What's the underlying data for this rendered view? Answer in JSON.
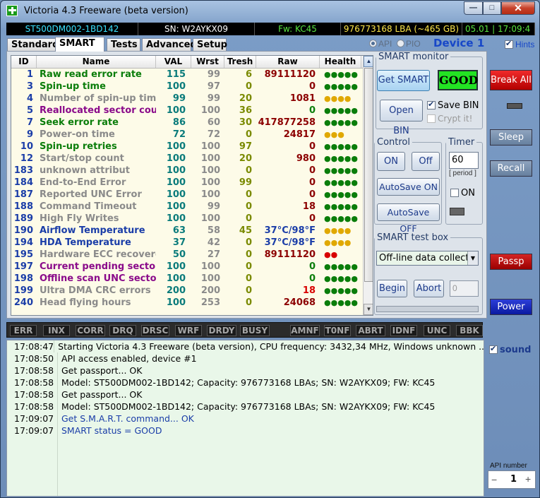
{
  "window": {
    "title": "Victoria 4.3 Freeware (beta version)",
    "min": "—",
    "max": "□",
    "close": "✕"
  },
  "info": {
    "model": "ST500DM002-1BD142",
    "serial": "SN: W2AYKX09",
    "firmware": "Fw: KC45",
    "lba": "976773168 LBA (~465 GB)",
    "time": "05.01 | 17:09:4"
  },
  "tabs": [
    "Standard",
    "SMART",
    "Tests",
    "Advanced",
    "Setup"
  ],
  "active_tab": "SMART",
  "iface": {
    "api": "API",
    "pio": "PIO",
    "device": "Device 1",
    "hints": "Hints"
  },
  "table": {
    "headers": [
      "ID",
      "Name",
      "VAL",
      "Wrst",
      "Tresh",
      "Raw",
      "Health"
    ],
    "rows": [
      {
        "id": "1",
        "name": "Raw read error rate",
        "val": "115",
        "wrst": "99",
        "tresh": "6",
        "raw": "89111120",
        "health": "●●●●●",
        "nc": "#0a7d0a",
        "hc": "#0a7d0a"
      },
      {
        "id": "3",
        "name": "Spin-up time",
        "val": "100",
        "wrst": "97",
        "tresh": "0",
        "raw": "0",
        "health": "●●●●●",
        "nc": "#0a7d0a",
        "hc": "#0a7d0a"
      },
      {
        "id": "4",
        "name": "Number of spin-up times",
        "val": "99",
        "wrst": "99",
        "tresh": "20",
        "raw": "1081",
        "health": "●●●●",
        "nc": "#8a8a8a",
        "hc": "#e0a800"
      },
      {
        "id": "5",
        "name": "Reallocated sector count",
        "val": "100",
        "wrst": "100",
        "tresh": "36",
        "raw": "0",
        "health": "●●●●●",
        "nc": "#8a0a8a",
        "hc": "#0a7d0a",
        "rc": "#0a7d0a"
      },
      {
        "id": "7",
        "name": "Seek error rate",
        "val": "86",
        "wrst": "60",
        "tresh": "30",
        "raw": "417877258",
        "health": "●●●●●",
        "nc": "#0a7d0a",
        "hc": "#0a7d0a"
      },
      {
        "id": "9",
        "name": "Power-on time",
        "val": "72",
        "wrst": "72",
        "tresh": "0",
        "raw": "24817",
        "health": "●●●",
        "nc": "#8a8a8a",
        "hc": "#e0a800"
      },
      {
        "id": "10",
        "name": "Spin-up retries",
        "val": "100",
        "wrst": "100",
        "tresh": "97",
        "raw": "0",
        "health": "●●●●●",
        "nc": "#0a7d0a",
        "hc": "#0a7d0a"
      },
      {
        "id": "12",
        "name": "Start/stop count",
        "val": "100",
        "wrst": "100",
        "tresh": "20",
        "raw": "980",
        "health": "●●●●●",
        "nc": "#8a8a8a",
        "hc": "#0a7d0a"
      },
      {
        "id": "183",
        "name": "unknown attribut",
        "val": "100",
        "wrst": "100",
        "tresh": "0",
        "raw": "0",
        "health": "●●●●●",
        "nc": "#8a8a8a",
        "hc": "#0a7d0a"
      },
      {
        "id": "184",
        "name": "End-to-End Error",
        "val": "100",
        "wrst": "100",
        "tresh": "99",
        "raw": "0",
        "health": "●●●●●",
        "nc": "#8a8a8a",
        "hc": "#0a7d0a"
      },
      {
        "id": "187",
        "name": "Reported UNC Error",
        "val": "100",
        "wrst": "100",
        "tresh": "0",
        "raw": "0",
        "health": "●●●●●",
        "nc": "#8a8a8a",
        "hc": "#0a7d0a"
      },
      {
        "id": "188",
        "name": "Command Timeout",
        "val": "100",
        "wrst": "99",
        "tresh": "0",
        "raw": "18",
        "health": "●●●●●",
        "nc": "#8a8a8a",
        "hc": "#0a7d0a"
      },
      {
        "id": "189",
        "name": "High Fly Writes",
        "val": "100",
        "wrst": "100",
        "tresh": "0",
        "raw": "0",
        "health": "●●●●●",
        "nc": "#8a8a8a",
        "hc": "#0a7d0a"
      },
      {
        "id": "190",
        "name": "Airflow Temperature",
        "val": "63",
        "wrst": "58",
        "tresh": "45",
        "raw": "37°C/98°F",
        "health": "●●●●",
        "nc": "#1a3da8",
        "hc": "#e0a800",
        "rc": "#1a3da8"
      },
      {
        "id": "194",
        "name": "HDA Temperature",
        "val": "37",
        "wrst": "42",
        "tresh": "0",
        "raw": "37°C/98°F",
        "health": "●●●●",
        "nc": "#1a3da8",
        "hc": "#e0a800",
        "rc": "#1a3da8"
      },
      {
        "id": "195",
        "name": "Hardware ECC recovered",
        "val": "50",
        "wrst": "27",
        "tresh": "0",
        "raw": "89111120",
        "health": "●●",
        "nc": "#8a8a8a",
        "hc": "#d80000"
      },
      {
        "id": "197",
        "name": "Current pending sectors",
        "val": "100",
        "wrst": "100",
        "tresh": "0",
        "raw": "0",
        "health": "●●●●●",
        "nc": "#8a0a8a",
        "hc": "#0a7d0a",
        "rc": "#0a7d0a"
      },
      {
        "id": "198",
        "name": "Offline scan UNC sectors",
        "val": "100",
        "wrst": "100",
        "tresh": "0",
        "raw": "0",
        "health": "●●●●●",
        "nc": "#8a0a8a",
        "hc": "#0a7d0a",
        "rc": "#0a7d0a"
      },
      {
        "id": "199",
        "name": "Ultra DMA CRC errors",
        "val": "200",
        "wrst": "200",
        "tresh": "0",
        "raw": "18",
        "health": "●●●●●",
        "nc": "#8a8a8a",
        "hc": "#0a7d0a",
        "rc": "#d80000"
      },
      {
        "id": "240",
        "name": "Head flying hours",
        "val": "100",
        "wrst": "253",
        "tresh": "0",
        "raw": "24068",
        "health": "●●●●●",
        "nc": "#8a8a8a",
        "hc": "#0a7d0a"
      }
    ]
  },
  "smart_monitor": {
    "legend": "SMART monitor",
    "get_smart": "Get SMART",
    "status": "GOOD",
    "open_bin": "Open BIN",
    "save_bin": "Save BIN",
    "crypt": "Crypt it!"
  },
  "control": {
    "legend": "Control",
    "on": "ON",
    "off": "Off",
    "autosave_on": "AutoSave ON",
    "autosave_off": "AutoSave OFF"
  },
  "timer": {
    "legend": "Timer",
    "value": "60",
    "period": "[ period ]",
    "on": "ON"
  },
  "test_box": {
    "legend": "SMART test box",
    "selected": "Off-line data collect",
    "begin": "Begin",
    "abort": "Abort",
    "field": "0"
  },
  "side": {
    "break_all": "Break All",
    "sleep": "Sleep",
    "recall": "Recall",
    "passp": "Passp",
    "power": "Power",
    "sound": "sound",
    "api_number_label": "API number",
    "api_number": "1",
    "minus": "−",
    "plus": "+"
  },
  "leds_left": [
    "ERR",
    "INX",
    "CORR",
    "DRQ",
    "DRSC",
    "WRF",
    "DRDY",
    "BUSY"
  ],
  "leds_right": [
    "AMNF",
    "T0NF",
    "ABRT",
    "IDNF",
    "UNC",
    "BBK"
  ],
  "log": [
    {
      "time": "17:08:47",
      "msg": "Starting Victoria 4.3 Freeware (beta version), CPU frequency: 3432,34 MHz, Windows unknown ...",
      "color": "#000000"
    },
    {
      "time": "17:08:50",
      "msg": "API access enabled, device #1",
      "color": "#000000"
    },
    {
      "time": "17:08:58",
      "msg": "Get passport... OK",
      "color": "#000000"
    },
    {
      "time": "17:08:58",
      "msg": "Model: ST500DM002-1BD142; Capacity: 976773168 LBAs; SN: W2AYKX09; FW: KC45",
      "color": "#000000"
    },
    {
      "time": "17:08:58",
      "msg": "Get passport... OK",
      "color": "#000000"
    },
    {
      "time": "17:08:58",
      "msg": "Model: ST500DM002-1BD142; Capacity: 976773168 LBAs; SN: W2AYKX09; FW: KC45",
      "color": "#000000"
    },
    {
      "time": "17:09:07",
      "msg": "Get S.M.A.R.T. command... OK",
      "color": "#1a3da8"
    },
    {
      "time": "17:09:07",
      "msg": "SMART status = GOOD",
      "color": "#1a3da8"
    }
  ]
}
